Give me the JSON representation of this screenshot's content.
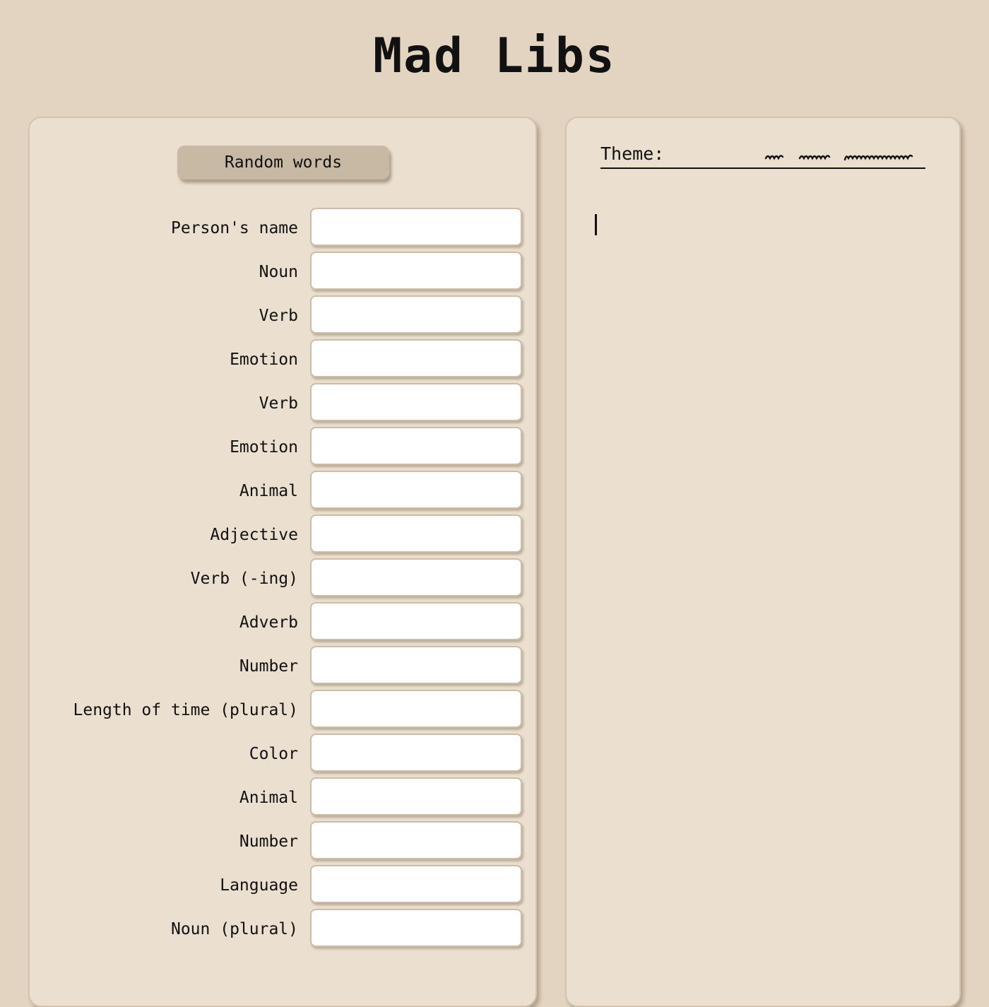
{
  "header": {
    "title": "Mad Libs"
  },
  "controls": {
    "random_label": "Random words"
  },
  "fields": [
    {
      "label": "Person's name",
      "value": ""
    },
    {
      "label": "Noun",
      "value": ""
    },
    {
      "label": "Verb",
      "value": ""
    },
    {
      "label": "Emotion",
      "value": ""
    },
    {
      "label": "Verb",
      "value": ""
    },
    {
      "label": "Emotion",
      "value": ""
    },
    {
      "label": "Animal",
      "value": ""
    },
    {
      "label": "Adjective",
      "value": ""
    },
    {
      "label": "Verb (-ing)",
      "value": ""
    },
    {
      "label": "Adverb",
      "value": ""
    },
    {
      "label": "Number",
      "value": ""
    },
    {
      "label": "Length of time (plural)",
      "value": ""
    },
    {
      "label": "Color",
      "value": ""
    },
    {
      "label": "Animal",
      "value": ""
    },
    {
      "label": "Number",
      "value": ""
    },
    {
      "label": "Language",
      "value": ""
    },
    {
      "label": "Noun (plural)",
      "value": ""
    }
  ],
  "story": {
    "theme_label": "Theme:",
    "text": ""
  },
  "colors": {
    "background": "#e3d4c1",
    "panel": "#ebdfd0",
    "button": "#c8b9a4",
    "input": "#ffffff",
    "text": "#111111"
  }
}
